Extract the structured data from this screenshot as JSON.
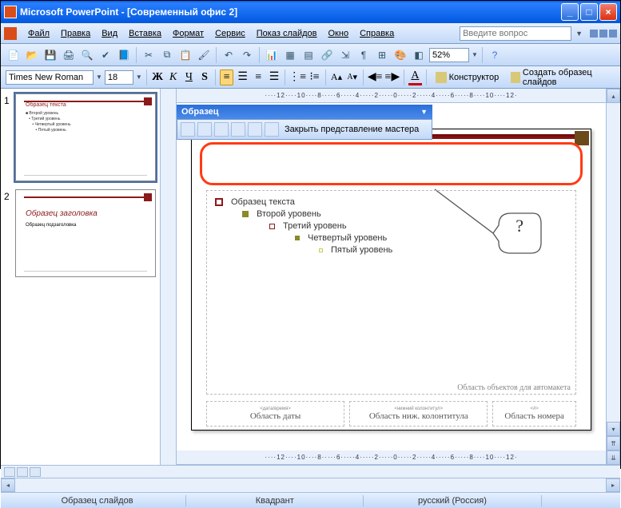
{
  "app": {
    "title": "Microsoft PowerPoint - [Современный офис 2]"
  },
  "menu": {
    "items": [
      "Файл",
      "Правка",
      "Вид",
      "Вставка",
      "Формат",
      "Сервис",
      "Показ слайдов",
      "Окно",
      "Справка"
    ],
    "help_placeholder": "Введите вопрос"
  },
  "toolbar": {
    "zoom": "52%"
  },
  "format": {
    "font": "Times New Roman",
    "size": "18",
    "designer": "Конструктор",
    "new_master": "Создать образец слайдов"
  },
  "ruler_h": "····12····10····8·····6·····4·····2·····0·····2·····4·····6·····8····10····12·",
  "thumbs": {
    "s1": {
      "num": "1",
      "title": "Образец текста",
      "body": "■ Второй уровень\n   • Третий уровень\n      • Четвертый уровень\n         • Пятый уровень"
    },
    "s2": {
      "num": "2",
      "title": "Образец заголовка",
      "body": "Образец подзаголовка"
    }
  },
  "floatbar": {
    "title": "Образец",
    "close_master": "Закрыть представление мастера"
  },
  "slide": {
    "lvl1": "Образец текста",
    "lvl2": "Второй уровень",
    "lvl3": "Третий уровень",
    "lvl4": "Четвертый уровень",
    "lvl5": "Пятый уровень",
    "autolayout": "Область объектов для автомакета",
    "callout": "?",
    "footers": {
      "date_tiny": "<дата/время>",
      "date": "Область даты",
      "footer_tiny": "<нижний колонтитул>",
      "footer": "Область ниж. колонтитула",
      "num_tiny": "<#>",
      "num": "Область номера"
    }
  },
  "status": {
    "left": "Образец слайдов",
    "center": "Квадрант",
    "right": "русский (Россия)"
  }
}
